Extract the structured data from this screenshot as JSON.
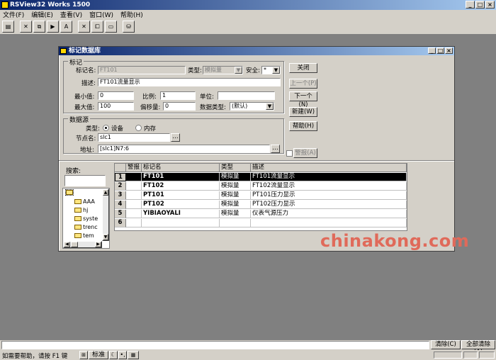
{
  "app": {
    "title": "RSView32 Works 1500"
  },
  "menu": {
    "items": [
      "文件(F)",
      "编辑(E)",
      "查看(V)",
      "窗口(W)",
      "帮助(H)"
    ]
  },
  "toolbar": {
    "icons": [
      "open-icon",
      "cut-icon",
      "copy-icon",
      "paste-icon",
      "text-icon",
      "tag-icon",
      "window-icon",
      "minimize-icon",
      "database-icon"
    ]
  },
  "window": {
    "title": "标记数据库",
    "tag_group": {
      "label": "标记",
      "name_label": "标记名:",
      "name_value": "FT101",
      "type_label": "类型:",
      "type_value": "模拟量",
      "security_label": "安全:",
      "security_value": "*",
      "desc_label": "描述:",
      "desc_value": "FT101流量显示",
      "min_label": "最小值:",
      "min_value": "0",
      "scale_label": "比例:",
      "scale_value": "1",
      "unit_label": "单位:",
      "unit_value": "",
      "max_label": "最大值:",
      "max_value": "100",
      "offset_label": "偏移量:",
      "offset_value": "0",
      "datatype_label": "数据类型:",
      "datatype_value": "(默认)"
    },
    "source_group": {
      "label": "数据源",
      "type_label": "类型:",
      "device_label": "设备",
      "memory_label": "内存",
      "node_label": "节点名:",
      "node_value": "slc1",
      "addr_label": "地址:",
      "addr_value": "[slc1]N7:6"
    },
    "buttons": {
      "close": "关闭",
      "prev": "上一个(P)",
      "next": "下一个(N)",
      "new": "新建(W)",
      "help": "帮助(H)",
      "alarm": "警报(A)"
    },
    "search": {
      "label": "搜索:",
      "value": ""
    },
    "tree": [
      "AAA",
      "hj",
      "syste",
      "trenc",
      "tem"
    ],
    "grid": {
      "headers": [
        "警报",
        "标记名",
        "类型",
        "描述"
      ],
      "rows": [
        {
          "num": "1",
          "alarm": "",
          "name": "FT101",
          "type": "模拟量",
          "desc": "FT101流量显示"
        },
        {
          "num": "2",
          "alarm": "",
          "name": "FT102",
          "type": "模拟量",
          "desc": "FT102流量显示"
        },
        {
          "num": "3",
          "alarm": "",
          "name": "PT101",
          "type": "模拟量",
          "desc": "PT101压力显示"
        },
        {
          "num": "4",
          "alarm": "",
          "name": "PT102",
          "type": "模拟量",
          "desc": "PT102压力显示"
        },
        {
          "num": "5",
          "alarm": "",
          "name": "YIBIAOYALI",
          "type": "模拟量",
          "desc": "仪表气源压力"
        },
        {
          "num": "6",
          "alarm": "",
          "name": "",
          "type": "",
          "desc": ""
        }
      ]
    }
  },
  "watermark": "chinakong.com",
  "cmdbar": {
    "clear": "清除(C)",
    "clear_all": "全部清除(A)"
  },
  "status": {
    "help_text": "如需要帮助，请按 F1 键",
    "ime": "标准"
  }
}
